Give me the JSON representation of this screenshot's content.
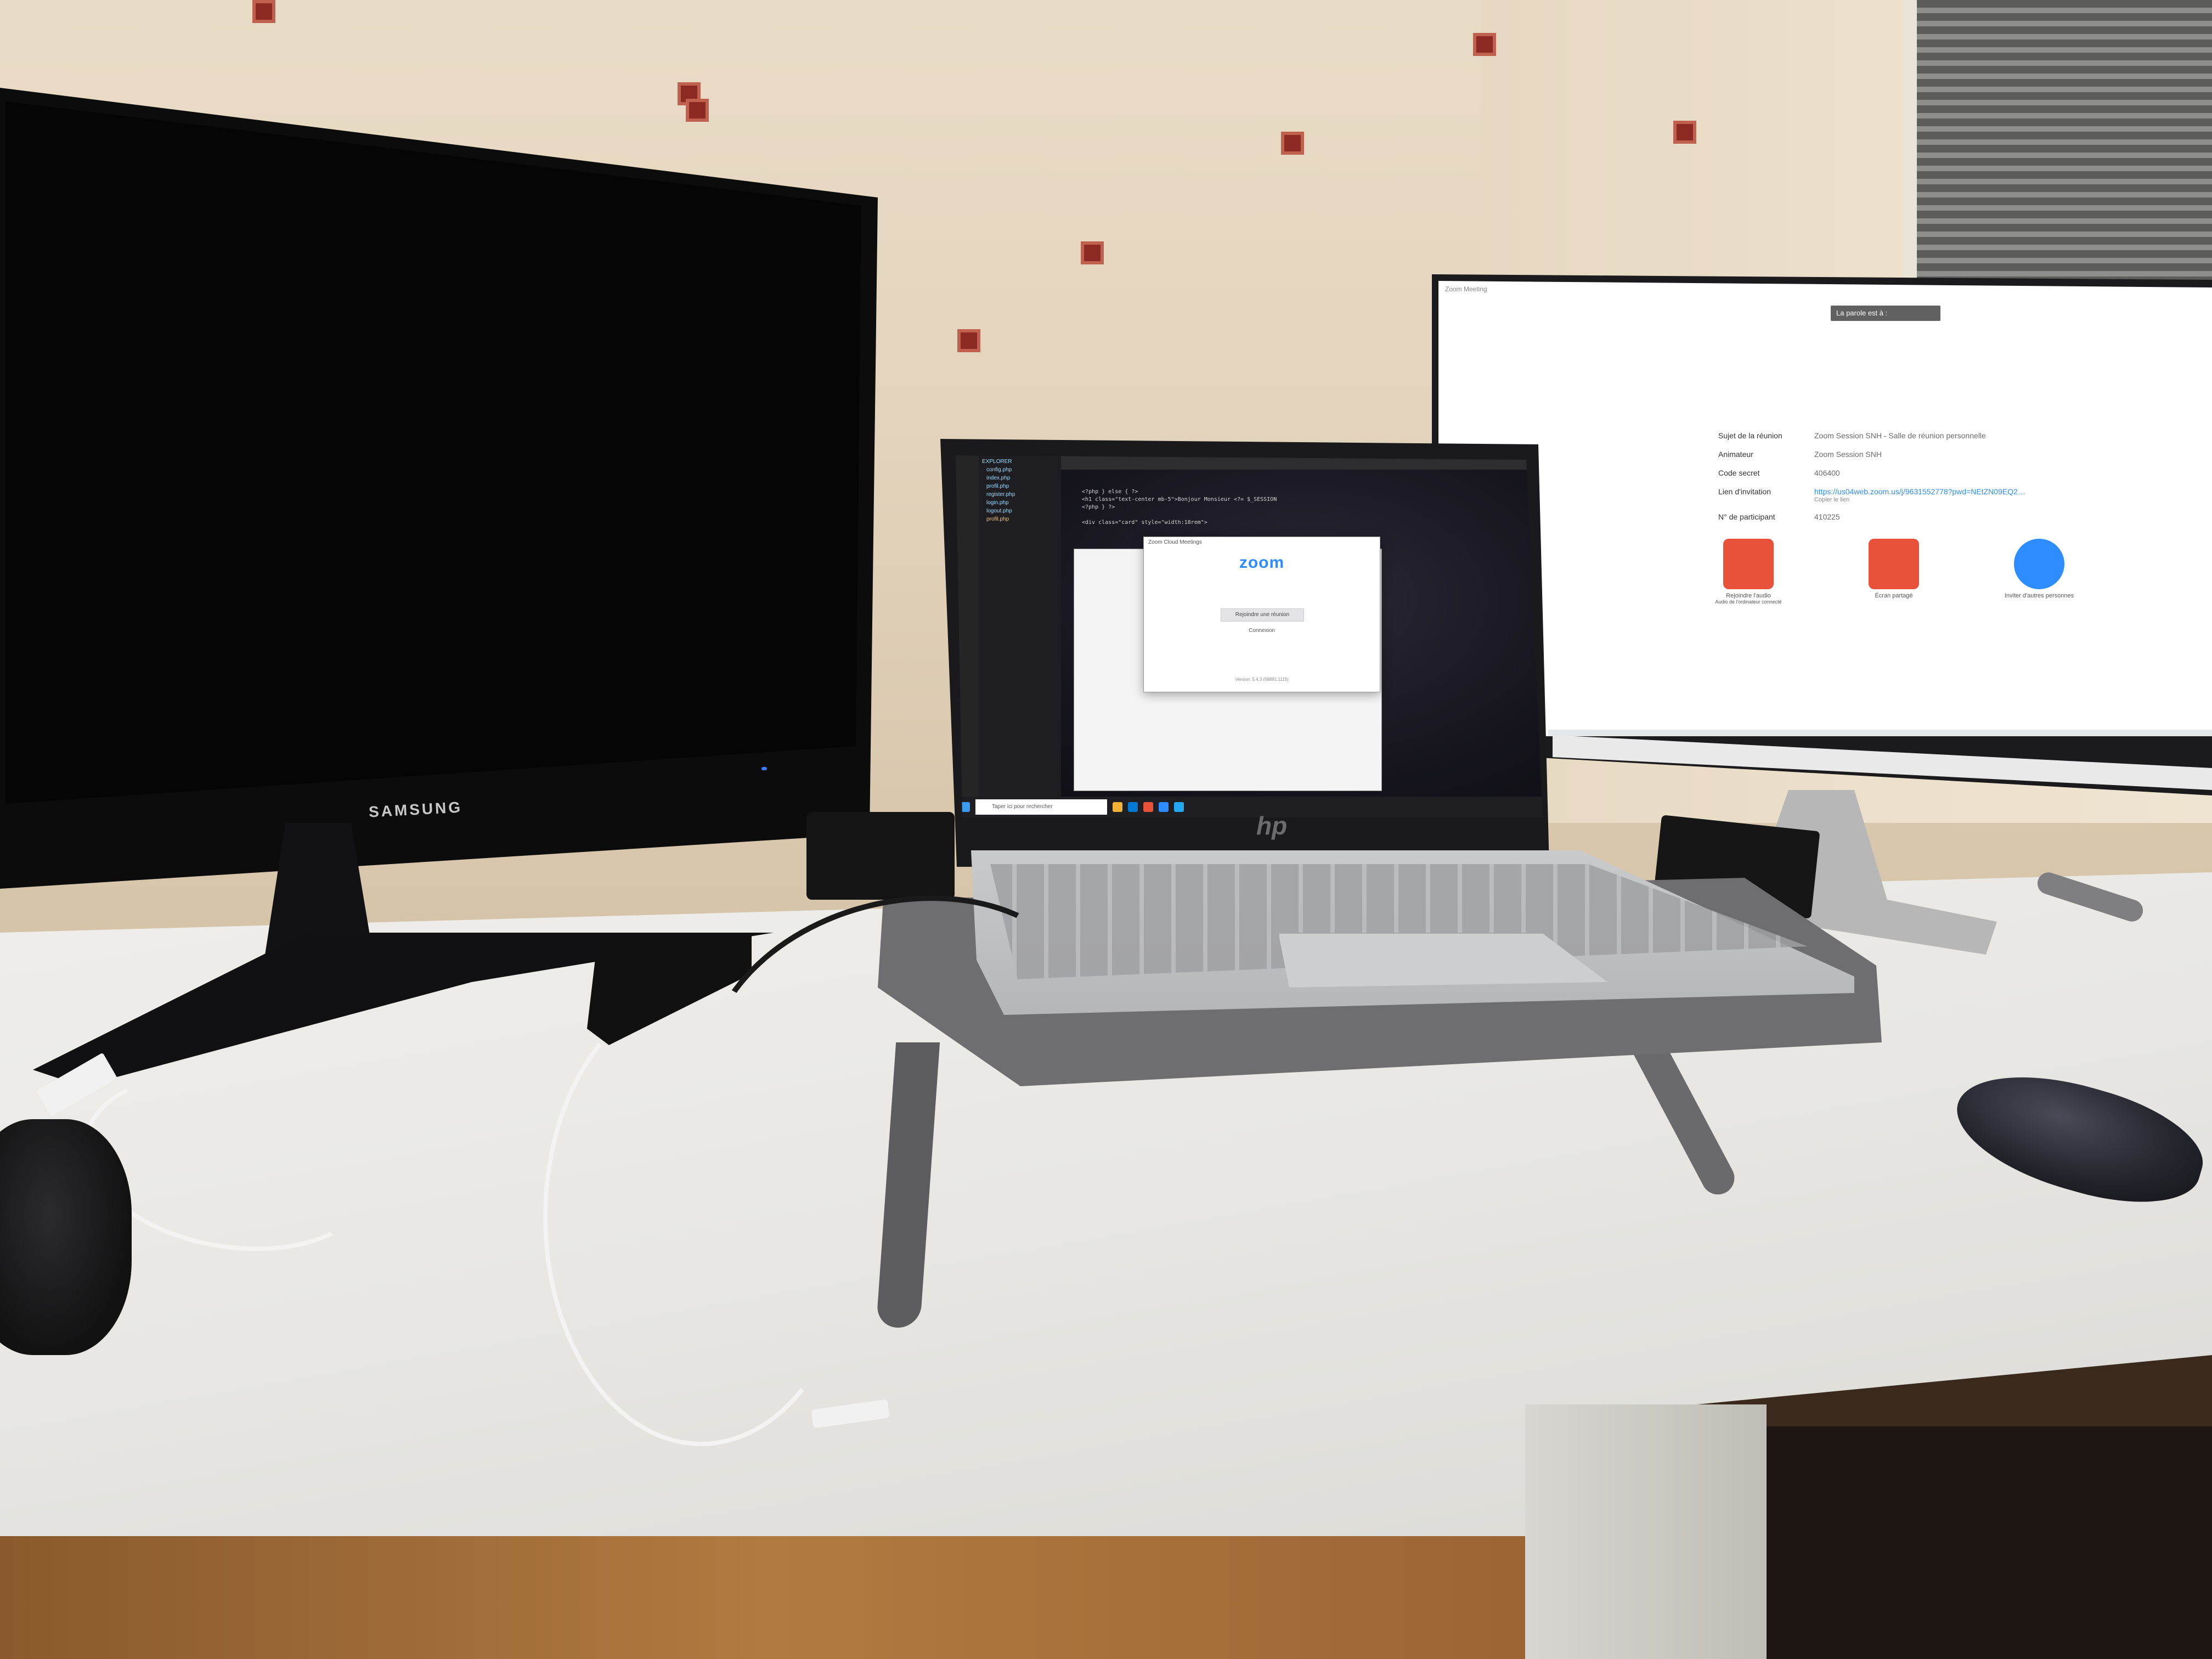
{
  "samsung_monitor": {
    "brand": "SAMSUNG"
  },
  "hp_monitor": {
    "window_title": "Zoom Meeting",
    "meeting_status_bar": "La parole est à :",
    "meeting_info": [
      {
        "label": "Sujet de la réunion",
        "value": "Zoom Session SNH - Salle de réunion personnelle"
      },
      {
        "label": "Animateur",
        "value": "Zoom Session SNH"
      },
      {
        "label": "Code secret",
        "value": "406400"
      },
      {
        "label": "Lien d'invitation",
        "value": "https://us04web.zoom.us/j/9631552778?pwd=NEtZN09EQ2…"
      },
      {
        "label": "N° de participant",
        "value": "410225"
      }
    ],
    "copy_link_label": "Copier le lien",
    "actions": [
      {
        "label": "Rejoindre l'audio",
        "sublabel": "Audio de l'ordinateur connecté",
        "icon": "headset-icon",
        "color": "#e8523b"
      },
      {
        "label": "Écran partagé",
        "sublabel": "",
        "icon": "share-screen-icon",
        "color": "#e8523b"
      },
      {
        "label": "Inviter d'autres personnes",
        "sublabel": "",
        "icon": "add-person-icon",
        "color": "#2d8cff"
      }
    ]
  },
  "laptop": {
    "brand_logo": "hp",
    "code_lines": [
      "<?php } else { ?>",
      "  <h1 class=\"text-center mb-5\">Bonjour Monsieur <?= $_SESSION",
      "<?php } ?>",
      "",
      "<div class=\"card\" style=\"width:18rem\">"
    ],
    "file_tree": [
      "EXPLORER",
      "config.php",
      "index.php",
      "profil.php",
      "register.php",
      "login.php",
      "logout.php",
      "profil.php"
    ],
    "zoom_dialog": {
      "title": "Zoom Cloud Meetings",
      "logo": "zoom",
      "join_button": "Rejoindre une réunion",
      "signin": "Connexion",
      "version": "Version: 5.4.3 (58891.1115)"
    },
    "taskbar_search": "Taper ici pour rechercher"
  },
  "colors": {
    "zoom_blue": "#2d8cff",
    "wall": "#e6d8c1",
    "desk": "#ecebe7"
  }
}
